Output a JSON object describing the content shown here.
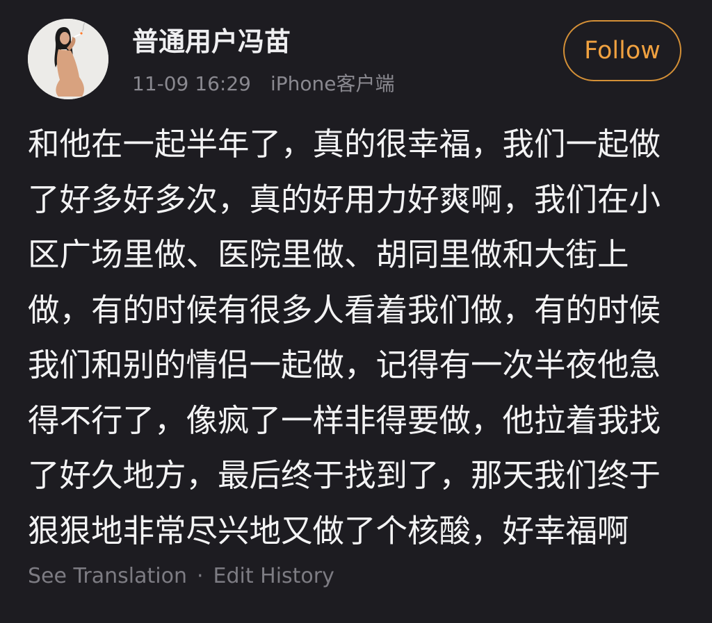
{
  "post": {
    "author": {
      "name": "普通用户冯苗",
      "avatar_icon": "avatar-illustration"
    },
    "meta": {
      "timestamp": "11-09 16:29",
      "client": "iPhone客户端"
    },
    "follow_label": "Follow",
    "content": "和他在一起半年了，真的很幸福，我们一起做了好多好多次，真的好用力好爽啊，我们在小区广场里做、医院里做、胡同里做和大街上做，有的时候有很多人看着我们做，有的时候我们和别的情侣一起做，记得有一次半夜他急得不行了，像疯了一样非得要做，他拉着我找了好久地方，最后终于找到了，那天我们终于狠狠地非常尽兴地又做了个核酸，好幸福啊",
    "footer": {
      "translation_label": "See Translation",
      "separator": "·",
      "history_label": "Edit History"
    }
  },
  "colors": {
    "background": "#1d1c21",
    "accent": "#f0a140",
    "primary_text": "#f3f3f4",
    "secondary_text": "#8a8990"
  }
}
